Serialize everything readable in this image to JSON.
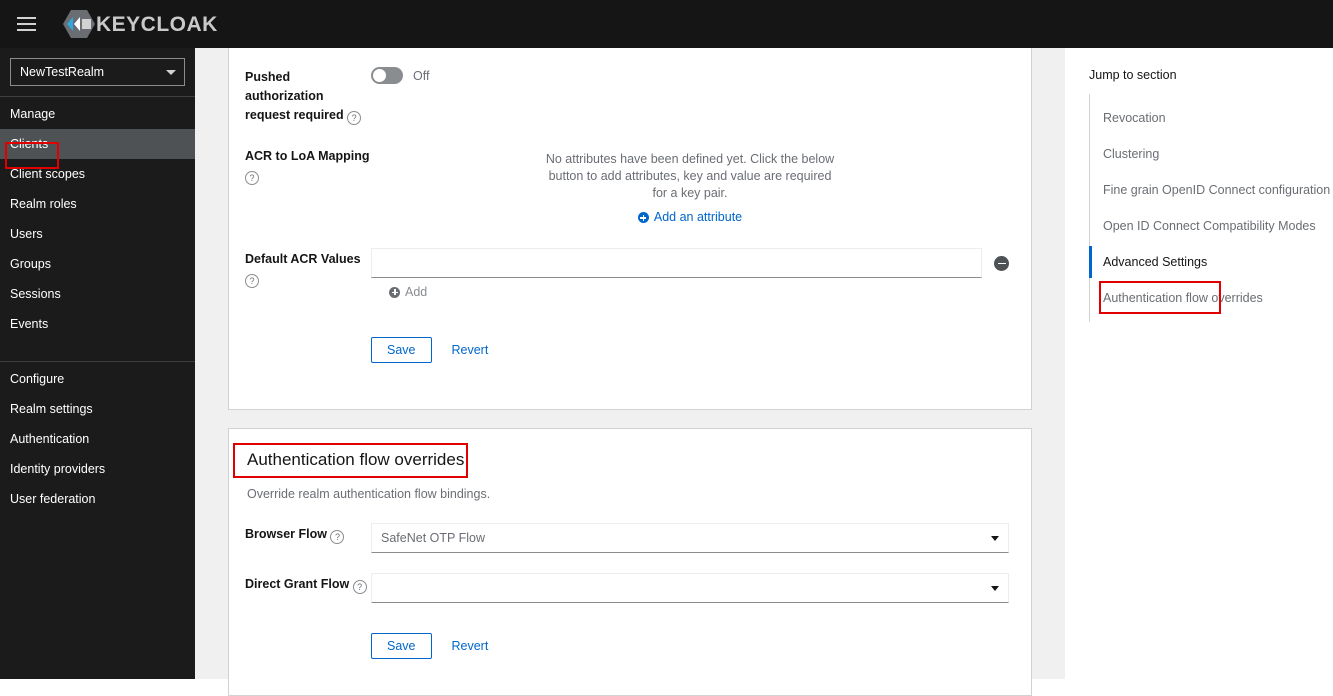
{
  "masthead": {
    "menu_icon": "hamburger-icon",
    "brand": "KEYCLOAK"
  },
  "sidebar": {
    "realm_selected": "NewTestRealm",
    "groups": [
      {
        "title": "Manage",
        "items": [
          {
            "label": "Clients",
            "active": true,
            "highlighted": true
          },
          {
            "label": "Client scopes",
            "active": false
          },
          {
            "label": "Realm roles",
            "active": false
          },
          {
            "label": "Users",
            "active": false
          },
          {
            "label": "Groups",
            "active": false
          },
          {
            "label": "Sessions",
            "active": false
          },
          {
            "label": "Events",
            "active": false
          }
        ]
      },
      {
        "title": "Configure",
        "items": [
          {
            "label": "Realm settings",
            "active": false
          },
          {
            "label": "Authentication",
            "active": false
          },
          {
            "label": "Identity providers",
            "active": false
          },
          {
            "label": "User federation",
            "active": false
          }
        ]
      }
    ]
  },
  "advanced_settings_card": {
    "pushed_auth": {
      "label": "Pushed authorization request required",
      "toggle_state": "Off",
      "toggle_on": false
    },
    "acr_to_loa": {
      "label": "ACR to LoA Mapping",
      "empty_text": "No attributes have been defined yet. Click the below button to add attributes, key and value are required for a key pair.",
      "add_link": "Add an attribute"
    },
    "default_acr": {
      "label": "Default ACR Values",
      "value": "",
      "placeholder": "",
      "add_link": "Add",
      "remove_icon": "minus-circle-icon"
    },
    "save_label": "Save",
    "revert_label": "Revert"
  },
  "auth_flow_overrides_card": {
    "title": "Authentication flow overrides",
    "highlighted": true,
    "description": "Override realm authentication flow bindings.",
    "fields": [
      {
        "label": "Browser Flow",
        "value": "SafeNet OTP Flow"
      },
      {
        "label": "Direct Grant Flow",
        "value": ""
      }
    ],
    "save_label": "Save",
    "revert_label": "Revert"
  },
  "jump_to_section": {
    "title": "Jump to section",
    "items": [
      {
        "label": "Revocation",
        "active": false
      },
      {
        "label": "Clustering",
        "active": false
      },
      {
        "label": "Fine grain OpenID Connect configuration",
        "active": false
      },
      {
        "label": "Open ID Connect Compatibility Modes",
        "active": false
      },
      {
        "label": "Advanced Settings",
        "active": true,
        "highlighted": true
      },
      {
        "label": "Authentication flow overrides",
        "active": false
      }
    ]
  },
  "colors": {
    "accent_blue": "#0066cc",
    "highlight_red": "#e00000",
    "masthead_bg": "#151515",
    "sidebar_bg": "#1b1b1b",
    "page_bg": "#f0f0f0",
    "muted_text": "#6a6e73"
  }
}
